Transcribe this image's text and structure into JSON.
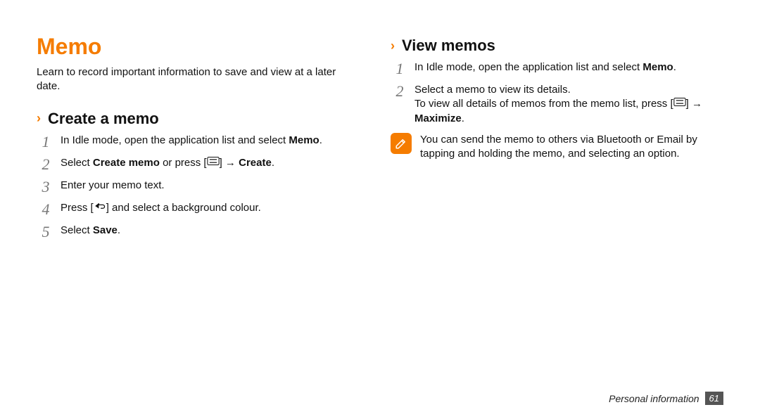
{
  "left": {
    "title": "Memo",
    "intro": "Learn to record important information to save and view at a later date.",
    "sub_chevron": "›",
    "sub_title": "Create a memo",
    "steps": {
      "n1": "1",
      "s1a": "In Idle mode, open the application list and select ",
      "s1b": "Memo",
      "s1c": ".",
      "n2": "2",
      "s2a": "Select ",
      "s2b": "Create memo",
      "s2c": " or press [",
      "s2d": "] → ",
      "s2e": "Create",
      "s2f": ".",
      "n3": "3",
      "s3": "Enter your memo text.",
      "n4": "4",
      "s4a": "Press [",
      "s4b": "] and select a background colour.",
      "n5": "5",
      "s5a": "Select ",
      "s5b": "Save",
      "s5c": "."
    }
  },
  "right": {
    "sub_chevron": "›",
    "sub_title": "View memos",
    "steps": {
      "n1": "1",
      "s1a": "In Idle mode, open the application list and select ",
      "s1b": "Memo",
      "s1c": ".",
      "n2": "2",
      "s2a": "Select a memo to view its details.",
      "s2b": "To view all details of memos from the memo list, press [",
      "s2c": "] → ",
      "s2d": "Maximize",
      "s2e": "."
    },
    "note": "You can send the memo to others via Bluetooth or Email by tapping and holding the memo, and selecting an option."
  },
  "footer": {
    "section": "Personal information",
    "page": "61"
  }
}
